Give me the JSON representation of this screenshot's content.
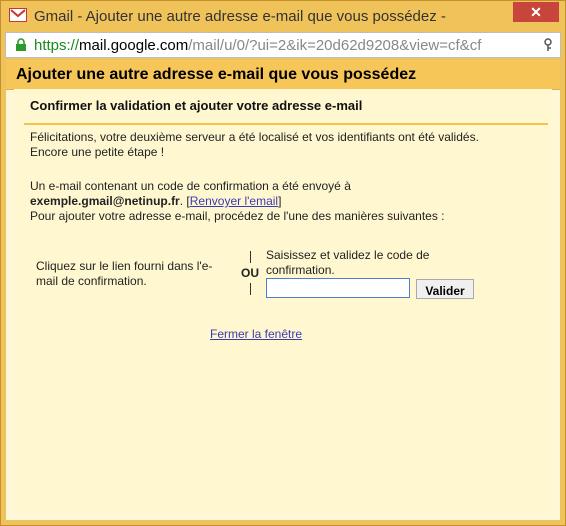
{
  "window": {
    "title": "Gmail - Ajouter une autre adresse e-mail que vous possédez -",
    "close_label": "✕"
  },
  "address_bar": {
    "protocol": "https://",
    "host": "mail.google.com",
    "path": "/mail/u/0/?ui=2&ik=20d62d9208&view=cf&cf"
  },
  "header": {
    "title": "Ajouter une autre adresse e-mail que vous possédez"
  },
  "panel": {
    "subtitle": "Confirmer la validation et ajouter votre adresse e-mail",
    "paragraph1_line1": "Félicitations, votre deuxième serveur a été localisé et vos identifiants ont été validés.",
    "paragraph1_line2": "Encore une petite étape !",
    "paragraph2_line1": "Un e-mail contenant un code de confirmation a été envoyé à",
    "email": "exemple.gmail@netinup.fr",
    "period": ".",
    "resend_open": "[",
    "resend_link": "Renvoyer l'email",
    "resend_close": "]",
    "paragraph2_line3": "Pour ajouter votre adresse e-mail, procédez de l'une des manières suivantes :",
    "left_option": "Cliquez sur le lien fourni dans l'e-mail de confirmation.",
    "divider_text": "OU",
    "right_option": "Saisissez et validez le code de confirmation.",
    "code_input_value": "",
    "validate_button": "Valider",
    "close_link": "Fermer la fenêtre"
  },
  "colors": {
    "accent": "#f7c659",
    "panel_bg": "#fff7d0",
    "link": "#3b3bb1"
  }
}
